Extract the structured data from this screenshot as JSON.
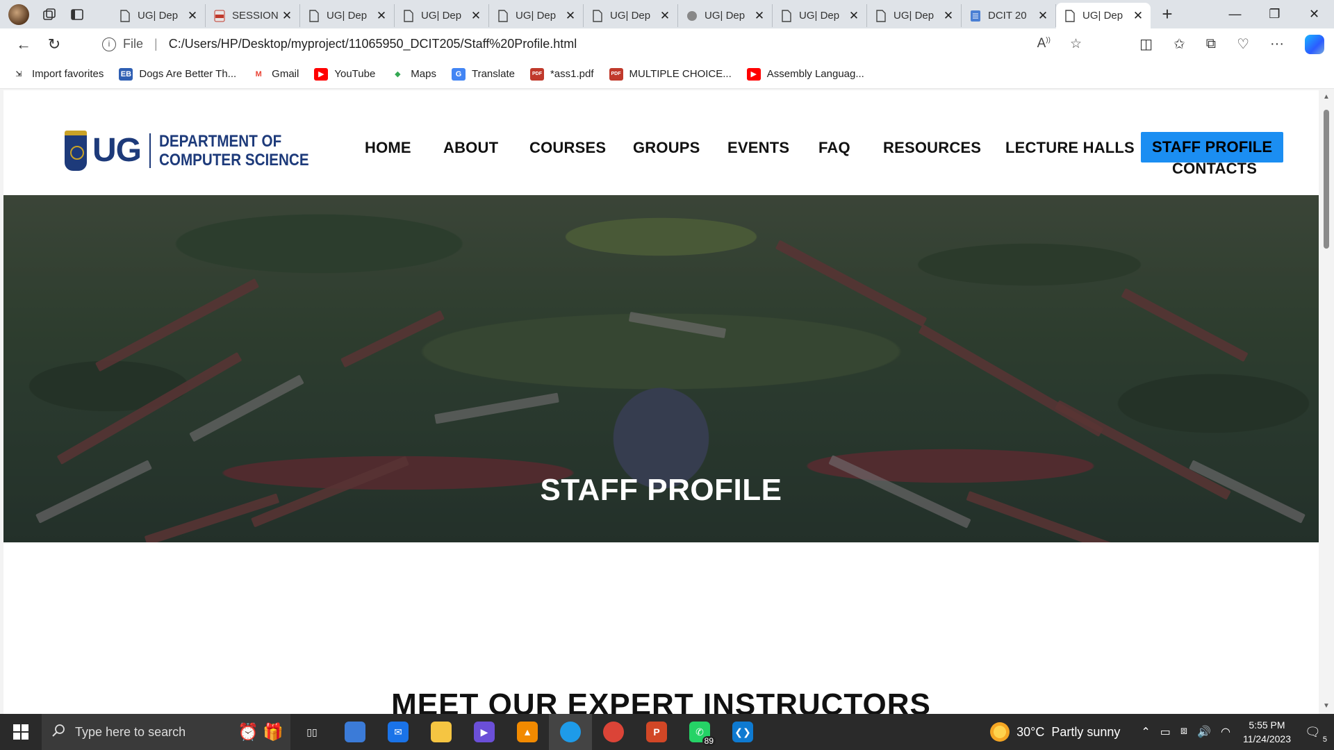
{
  "browser": {
    "tabs": [
      {
        "title": "UG| Dep",
        "icon": "page-icon",
        "active": false
      },
      {
        "title": "SESSION",
        "icon": "pdf-icon",
        "active": false
      },
      {
        "title": "UG| Dep",
        "icon": "page-icon",
        "active": false
      },
      {
        "title": "UG| Dep",
        "icon": "page-icon",
        "active": false
      },
      {
        "title": "UG| Dep",
        "icon": "page-icon",
        "active": false
      },
      {
        "title": "UG| Dep",
        "icon": "page-icon",
        "active": false
      },
      {
        "title": "UG| Dep",
        "icon": "site-icon",
        "active": false
      },
      {
        "title": "UG| Dep",
        "icon": "page-icon",
        "active": false
      },
      {
        "title": "UG| Dep",
        "icon": "page-icon",
        "active": false
      },
      {
        "title": "DCIT 20",
        "icon": "doc-icon",
        "active": false
      },
      {
        "title": "UG| Dep",
        "icon": "page-icon",
        "active": true
      }
    ],
    "address": {
      "scheme_label": "File",
      "url": "C:/Users/HP/Desktop/myproject/11065950_DCIT205/Staff%20Profile.html"
    },
    "favorites": [
      {
        "label": "Import favorites",
        "icon": "import-icon"
      },
      {
        "label": "Dogs Are Better Th...",
        "icon": "eb-icon"
      },
      {
        "label": "Gmail",
        "icon": "gmail-icon"
      },
      {
        "label": "YouTube",
        "icon": "youtube-icon"
      },
      {
        "label": "Maps",
        "icon": "maps-icon"
      },
      {
        "label": "Translate",
        "icon": "translate-icon"
      },
      {
        "label": "*ass1.pdf",
        "icon": "pdf-icon"
      },
      {
        "label": "MULTIPLE CHOICE...",
        "icon": "pdf-icon"
      },
      {
        "label": "Assembly Languag...",
        "icon": "youtube-icon"
      }
    ]
  },
  "site": {
    "logo": {
      "ug": "UG",
      "dept_line1": "DEPARTMENT OF",
      "dept_line2": "COMPUTER SCIENCE"
    },
    "menu": [
      {
        "label": "HOME",
        "active": false
      },
      {
        "label": "ABOUT",
        "active": false
      },
      {
        "label": "COURSES",
        "active": false
      },
      {
        "label": "GROUPS",
        "active": false
      },
      {
        "label": "EVENTS",
        "active": false
      },
      {
        "label": "FAQ",
        "active": false
      },
      {
        "label": "RESOURCES",
        "active": false
      },
      {
        "label": "LECTURE HALLS",
        "active": false
      },
      {
        "label": "STAFF PROFILE",
        "active": true
      },
      {
        "label": "CONTACTS",
        "active": false
      }
    ],
    "hero_title": "STAFF PROFILE",
    "section_title": "MEET OUR EXPERT INSTRUCTORS"
  },
  "taskbar": {
    "search_placeholder": "Type here to search",
    "apps": [
      {
        "name": "task-view",
        "active": false
      },
      {
        "name": "microsoft-store",
        "active": false
      },
      {
        "name": "mail",
        "active": false
      },
      {
        "name": "file-explorer",
        "active": false
      },
      {
        "name": "clipchamp",
        "active": false
      },
      {
        "name": "vlc",
        "active": false
      },
      {
        "name": "edge",
        "active": true
      },
      {
        "name": "chrome",
        "active": false
      },
      {
        "name": "powerpoint",
        "active": false
      },
      {
        "name": "whatsapp",
        "active": false,
        "badge": "89"
      },
      {
        "name": "vscode",
        "active": false
      }
    ],
    "weather": {
      "temp": "30°C",
      "condition": "Partly sunny"
    },
    "time": "5:55 PM",
    "date": "11/24/2023",
    "notification_count": "5"
  },
  "colors": {
    "accent": "#1b8ef2",
    "brand": "#1d3a7a"
  }
}
